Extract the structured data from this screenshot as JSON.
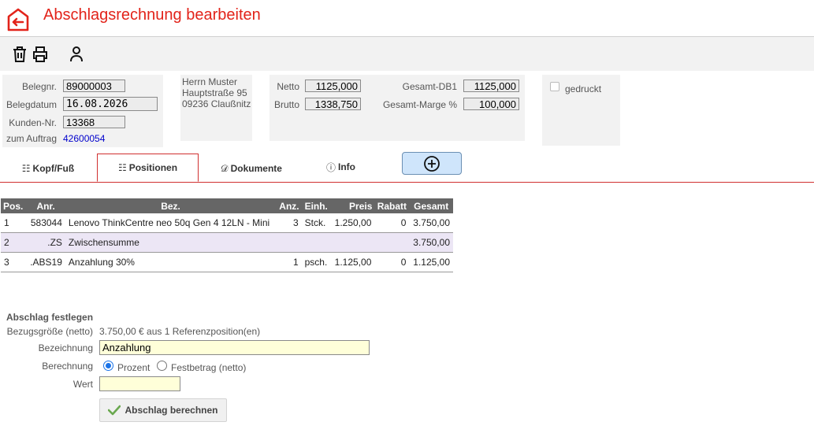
{
  "header": {
    "title": "Abschlagsrechnung bearbeiten"
  },
  "colors": {
    "accent": "#e2231a",
    "input_yellow": "#ffffd9",
    "add_tab_bg": "#cfe5fb"
  },
  "toolbar": {
    "icons": [
      "trash-icon",
      "print-icon",
      "person-icon"
    ]
  },
  "beleg": {
    "belegnr_label": "Belegnr.",
    "belegnr": "89000003",
    "belegdatum_label": "Belegdatum",
    "belegdatum": "16.08.2026",
    "kundennr_label": "Kunden-Nr.",
    "kundennr": "13368",
    "auftrag_label": "zum Auftrag",
    "auftrag": "42600054"
  },
  "address": {
    "line1": "Herrn Muster",
    "line2": "Hauptstraße 95",
    "line3": "09236 Claußnitz"
  },
  "totals": {
    "netto_label": "Netto",
    "netto": "1125,000",
    "brutto_label": "Brutto",
    "brutto": "1338,750",
    "db_label": "Gesamt-DB1",
    "db": "1125,000",
    "marge_label": "Gesamt-Marge %",
    "marge": "100,000"
  },
  "status": {
    "gedruckt_label": "gedruckt",
    "gedruckt": false
  },
  "tabs": [
    {
      "icon": "☷",
      "label": "Kopf/Fuß"
    },
    {
      "icon": "☷",
      "label": "Positionen"
    },
    {
      "icon": "𝒟",
      "label": "Dokumente"
    },
    {
      "icon": "ⓘ",
      "label": "Info"
    }
  ],
  "table": {
    "headers": [
      "Pos.",
      "Anr.",
      "Bez.",
      "Anz.",
      "Einh.",
      "Preis",
      "Rabatt",
      "Gesamt"
    ],
    "rows": [
      [
        "1",
        "583044",
        "Lenovo ThinkCentre neo 50q Gen 4 12LN - Mini",
        "3",
        "Stck.",
        "1.250,00",
        "0",
        "3.750,00"
      ],
      [
        "2",
        ".ZS",
        "Zwischensumme",
        "",
        "",
        "",
        "",
        "3.750,00"
      ],
      [
        "3",
        ".ABS19",
        "Anzahlung 30%",
        "1",
        "psch.",
        "1.125,00",
        "0",
        "1.125,00"
      ]
    ]
  },
  "abschlag": {
    "title": "Abschlag festlegen",
    "bezug_label": "Bezugsgröße (netto)",
    "bezug_value": "3.750,00 € aus 1 Referenzposition(en)",
    "bez_label": "Bezeichnung",
    "bez_value": "Anzahlung",
    "ber_label": "Berechnung",
    "opt_prozent": "Prozent",
    "opt_fest": "Festbetrag (netto)",
    "wert_label": "Wert",
    "wert_value": "",
    "calc_button": "Abschlag berechnen"
  }
}
